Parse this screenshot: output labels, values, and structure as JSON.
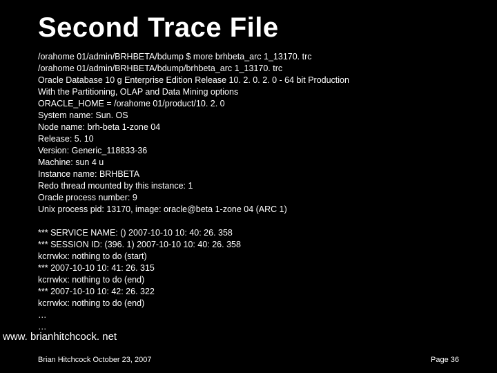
{
  "title": "Second Trace File",
  "lines": [
    "/orahome 01/admin/BRHBETA/bdump $ more brhbeta_arc 1_13170. trc",
    "/orahome 01/admin/BRHBETA/bdump/brhbeta_arc 1_13170. trc",
    "Oracle Database 10 g Enterprise Edition Release 10. 2. 0. 2. 0 - 64 bit Production",
    "With the Partitioning, OLAP and Data Mining options",
    "ORACLE_HOME = /orahome 01/product/10. 2. 0",
    "System name: Sun. OS",
    "Node name: brh-beta 1-zone 04",
    "Release: 5. 10",
    "Version: Generic_118833-36",
    "Machine: sun 4 u",
    "Instance name: BRHBETA",
    "Redo thread mounted by this instance: 1",
    "Oracle process number: 9",
    "Unix process pid: 13170, image: oracle@beta 1-zone 04 (ARC 1)",
    "",
    "*** SERVICE NAME: () 2007-10-10 10: 40: 26. 358",
    "*** SESSION ID: (396. 1) 2007-10-10 10: 40: 26. 358",
    "kcrrwkx: nothing to do (start)",
    "*** 2007-10-10 10: 41: 26. 315",
    "kcrrwkx: nothing to do (end)",
    "*** 2007-10-10 10: 42: 26. 322",
    "kcrrwkx: nothing to do (end)",
    "…",
    "…"
  ],
  "url": "www. brianhitchcock. net",
  "footer_left": "Brian Hitchcock  October 23, 2007",
  "footer_right": "Page 36"
}
